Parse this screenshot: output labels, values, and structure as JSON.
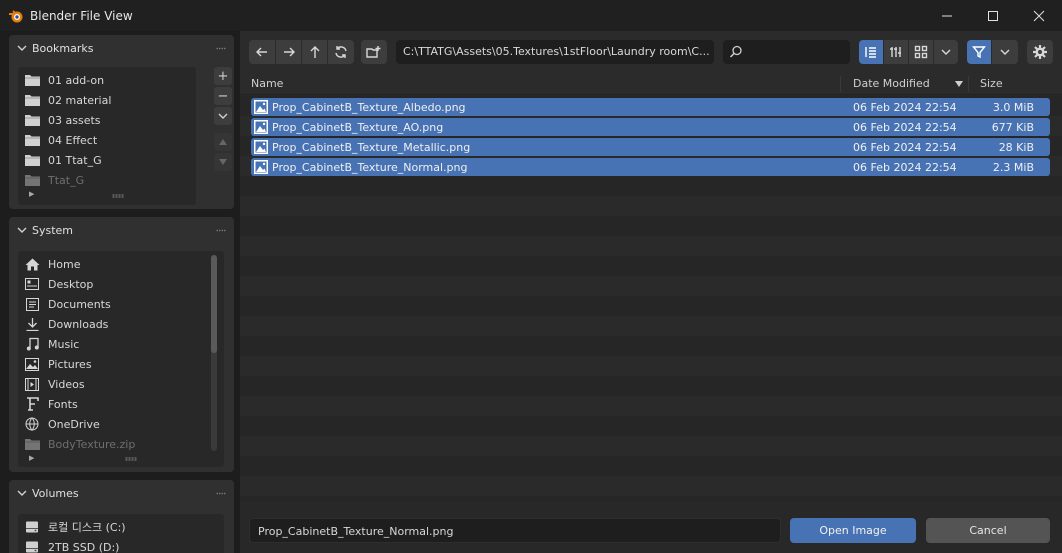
{
  "window": {
    "title": "Blender File View"
  },
  "bookmarks": {
    "header": "Bookmarks",
    "items": [
      {
        "label": "01 add-on",
        "icon": "folder-icon",
        "dim": false
      },
      {
        "label": "02 material",
        "icon": "folder-icon",
        "dim": false
      },
      {
        "label": "03 assets",
        "icon": "folder-icon",
        "dim": false
      },
      {
        "label": "04 Effect",
        "icon": "folder-icon",
        "dim": false
      },
      {
        "label": "01 Ttat_G",
        "icon": "folder-icon",
        "dim": false
      },
      {
        "label": "Ttat_G",
        "icon": "folder-icon",
        "dim": true
      }
    ],
    "buttons": [
      "+",
      "−"
    ]
  },
  "system": {
    "header": "System",
    "items": [
      {
        "label": "Home",
        "icon": "home-icon"
      },
      {
        "label": "Desktop",
        "icon": "desktop-icon"
      },
      {
        "label": "Documents",
        "icon": "documents-icon"
      },
      {
        "label": "Downloads",
        "icon": "downloads-icon"
      },
      {
        "label": "Music",
        "icon": "music-icon"
      },
      {
        "label": "Pictures",
        "icon": "pictures-icon"
      },
      {
        "label": "Videos",
        "icon": "videos-icon"
      },
      {
        "label": "Fonts",
        "icon": "fonts-icon"
      },
      {
        "label": "OneDrive",
        "icon": "onedrive-icon"
      },
      {
        "label": "BodyTexture.zip",
        "icon": "folder-icon"
      }
    ]
  },
  "volumes": {
    "header": "Volumes",
    "items": [
      {
        "label": "로컬 디스크 (C:)",
        "icon": "drive-icon"
      },
      {
        "label": "2TB SSD (D:)",
        "icon": "drive-icon"
      }
    ]
  },
  "toolbar": {
    "path": "C:\\TTATG\\Assets\\05.Textures\\1stFloor\\Laundry room\\C...",
    "search_value": ""
  },
  "columns": {
    "name": "Name",
    "date": "Date Modified",
    "size": "Size"
  },
  "files": [
    {
      "name": "Prop_CabinetB_Texture_Albedo.png",
      "date": "06 Feb 2024 22:54",
      "size": "3.0 MiB"
    },
    {
      "name": "Prop_CabinetB_Texture_AO.png",
      "date": "06 Feb 2024 22:54",
      "size": "677 KiB"
    },
    {
      "name": "Prop_CabinetB_Texture_Metallic.png",
      "date": "06 Feb 2024 22:54",
      "size": "28 KiB"
    },
    {
      "name": "Prop_CabinetB_Texture_Normal.png",
      "date": "06 Feb 2024 22:54",
      "size": "2.3 MiB"
    }
  ],
  "footer": {
    "filename": "Prop_CabinetB_Texture_Normal.png",
    "open_label": "Open Image",
    "cancel_label": "Cancel"
  },
  "colors": {
    "accent": "#4772b3",
    "background": "#1d1d1d",
    "panel": "#303030"
  }
}
